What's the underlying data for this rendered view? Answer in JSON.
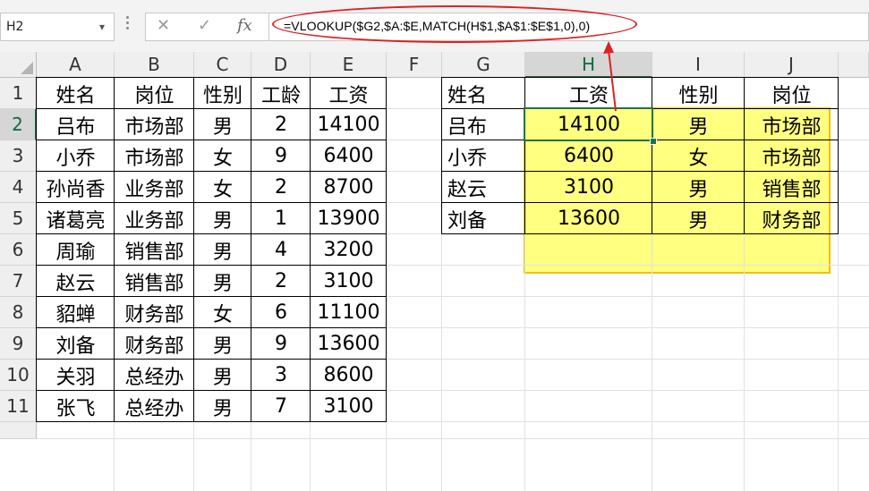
{
  "formula_bar": {
    "name_box": "H2",
    "formula": "=VLOOKUP($G2,$A:$E,MATCH(H$1,$A$1:$E$1,0),0)",
    "icons": [
      "cancel-icon",
      "confirm-icon",
      "function-icon"
    ]
  },
  "sheet": {
    "columns": [
      "A",
      "B",
      "C",
      "D",
      "E",
      "F",
      "G",
      "H",
      "I",
      "J"
    ],
    "rows": [
      "1",
      "2",
      "3",
      "4",
      "5",
      "6",
      "7",
      "8",
      "9",
      "10",
      "11"
    ],
    "active_cell": "H2",
    "table1": {
      "headers": [
        "姓名",
        "岗位",
        "性别",
        "工龄",
        "工资"
      ],
      "rows": [
        [
          "吕布",
          "市场部",
          "男",
          "2",
          "14100"
        ],
        [
          "小乔",
          "市场部",
          "女",
          "9",
          "6400"
        ],
        [
          "孙尚香",
          "业务部",
          "女",
          "2",
          "8700"
        ],
        [
          "诸葛亮",
          "业务部",
          "男",
          "1",
          "13900"
        ],
        [
          "周瑜",
          "销售部",
          "男",
          "4",
          "3200"
        ],
        [
          "赵云",
          "销售部",
          "男",
          "2",
          "3100"
        ],
        [
          "貂蝉",
          "财务部",
          "女",
          "6",
          "11100"
        ],
        [
          "刘备",
          "财务部",
          "男",
          "9",
          "13600"
        ],
        [
          "关羽",
          "总经办",
          "男",
          "3",
          "8600"
        ],
        [
          "张飞",
          "总经办",
          "男",
          "7",
          "3100"
        ]
      ]
    },
    "table2": {
      "headers": [
        "姓名",
        "工资",
        "性别",
        "岗位"
      ],
      "rows": [
        [
          "吕布",
          "14100",
          "男",
          "市场部"
        ],
        [
          "小乔",
          "6400",
          "女",
          "市场部"
        ],
        [
          "赵云",
          "3100",
          "男",
          "销售部"
        ],
        [
          "刘备",
          "13600",
          "男",
          "财务部"
        ]
      ]
    }
  },
  "colors": {
    "highlight": "#ffff80",
    "highlight_border": "#f0c000",
    "annotation": "#e02020",
    "excel_green": "#217346"
  }
}
